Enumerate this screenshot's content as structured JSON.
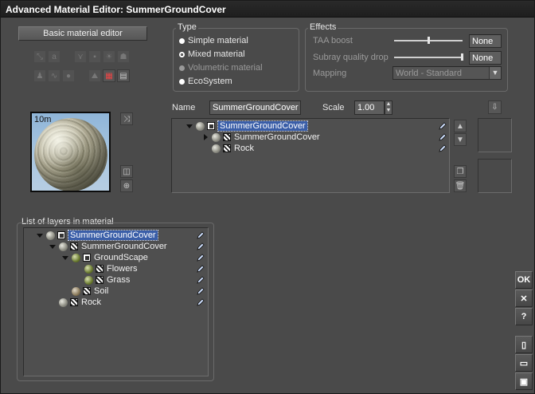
{
  "window": {
    "title": "Advanced Material Editor: SummerGroundCover"
  },
  "basic_editor_button": "Basic material editor",
  "type_group": {
    "title": "Type",
    "options": [
      {
        "label": "Simple material",
        "enabled": true,
        "selected": false
      },
      {
        "label": "Mixed material",
        "enabled": true,
        "selected": true
      },
      {
        "label": "Volumetric material",
        "enabled": false,
        "selected": false
      },
      {
        "label": "EcoSystem",
        "enabled": true,
        "selected": false
      }
    ]
  },
  "effects_group": {
    "title": "Effects",
    "taa_boost": {
      "label": "TAA boost",
      "value": "None",
      "slider_fraction": 0.5
    },
    "subray_quality_drop": {
      "label": "Subray quality drop",
      "value": "None",
      "slider_fraction": 1.0
    },
    "mapping": {
      "label": "Mapping",
      "value": "World - Standard"
    }
  },
  "preview": {
    "distance_label": "10m"
  },
  "name_field": {
    "label": "Name",
    "value": "SummerGroundCover"
  },
  "scale_field": {
    "label": "Scale",
    "value": "1.00"
  },
  "material_tree": [
    {
      "label": "SummerGroundCover",
      "depth": 0,
      "expanded": true,
      "icon": "mixed",
      "selected": true,
      "ball": "gray"
    },
    {
      "label": "SummerGroundCover",
      "depth": 1,
      "expanded": false,
      "icon": "checker",
      "selected": false,
      "ball": "gray"
    },
    {
      "label": "Rock",
      "depth": 1,
      "expanded": null,
      "icon": "checker",
      "selected": false,
      "ball": "gray"
    }
  ],
  "layers_panel": {
    "title": "List of layers in material",
    "items": [
      {
        "label": "SummerGroundCover",
        "depth": 0,
        "expanded": true,
        "icon": "mixed",
        "selected": true,
        "ball": "gray"
      },
      {
        "label": "SummerGroundCover",
        "depth": 1,
        "expanded": true,
        "icon": "checker",
        "selected": false,
        "ball": "gray"
      },
      {
        "label": "GroundScape",
        "depth": 2,
        "expanded": true,
        "icon": "mixed",
        "selected": false,
        "ball": "green"
      },
      {
        "label": "Flowers",
        "depth": 3,
        "expanded": null,
        "icon": "checker",
        "selected": false,
        "ball": "green"
      },
      {
        "label": "Grass",
        "depth": 3,
        "expanded": null,
        "icon": "checker",
        "selected": false,
        "ball": "green"
      },
      {
        "label": "Soil",
        "depth": 2,
        "expanded": null,
        "icon": "checker",
        "selected": false,
        "ball": "brown"
      },
      {
        "label": "Rock",
        "depth": 1,
        "expanded": null,
        "icon": "checker",
        "selected": false,
        "ball": "gray"
      }
    ]
  },
  "side_buttons": {
    "ok": "OK",
    "cancel": "✕",
    "help": "?"
  },
  "icons": {
    "toolbar": [
      "transform-icon",
      "text-icon",
      "distribution-icon",
      "small-square-icon",
      "sun-icon",
      "person-icon",
      "figure-icon",
      "wave-icon",
      "circle-icon",
      "terrain-icon",
      "film-icon",
      "clapper-icon"
    ],
    "preview_tools": [
      "shuffle-icon",
      "cube-icon",
      "zoom-icon"
    ],
    "layer_tools": [
      "up-arrow-icon",
      "down-arrow-icon",
      "copy-icon",
      "trash-icon",
      "import-icon"
    ],
    "file_tools": [
      "new-document-icon",
      "open-folder-icon",
      "save-icon"
    ]
  }
}
